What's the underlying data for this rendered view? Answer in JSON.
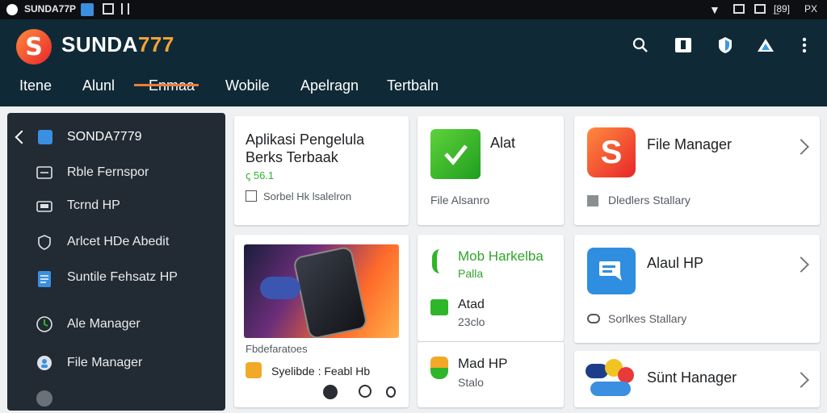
{
  "status_bar": {
    "app_name": "SUNDA77P",
    "right_text": "[̲89]",
    "right_label": "PX"
  },
  "app_bar": {
    "logo_letter": "S",
    "brand_main": "SUNDA",
    "brand_accent": "777",
    "tabs": [
      {
        "label": "Itene"
      },
      {
        "label": "Alunl"
      },
      {
        "label": "Enmaa"
      },
      {
        "label": "Wobile"
      },
      {
        "label": "Apelragn"
      },
      {
        "label": "Tertbaln"
      }
    ],
    "active_tab": "Enmaa"
  },
  "sidebar": {
    "header": "SONDA7779",
    "items": [
      {
        "label": "Rble Fernspor",
        "icon": "swap-icon"
      },
      {
        "label": "Tcrnd HP",
        "icon": "folder-icon"
      },
      {
        "label": "Arlcet HDe Abedit",
        "icon": "heart-shield-icon"
      },
      {
        "label": "Suntile Fehsatz HP",
        "icon": "document-icon"
      },
      {
        "label": "Ale Manager",
        "icon": "clock-icon"
      },
      {
        "label": "File Manager",
        "icon": "gear-icon"
      }
    ]
  },
  "cards": {
    "c1": {
      "title": "Aplikasi Pengelula Berks Terbaak",
      "badge": "ꞔ 56.1",
      "footer": "Sorbel Hk lsalelron"
    },
    "c2": {
      "title": "Alat",
      "footer": "File Alsanro"
    },
    "c3": {
      "title": "File Manager",
      "footer": "Dledlers Stallary"
    },
    "c4": {
      "caption": "Fbdefaratoes",
      "footer": "Syelibde : Feabl Hb"
    },
    "c5": {
      "title": "Mob Harkelba",
      "sub": "Palla",
      "title2": "Atad",
      "sub2": "23clo"
    },
    "c6": {
      "title": "Alaul HP",
      "footer": "Sorlkes Stallary"
    },
    "c7": {
      "title": "Mad HP",
      "sub": "Stalo"
    },
    "c8": {
      "title": "Sünt Hanager"
    }
  },
  "colors": {
    "appbar": "#0f2a36",
    "accent": "#ef7a3a",
    "sidebar": "#222a33",
    "green": "#2fb52a"
  }
}
